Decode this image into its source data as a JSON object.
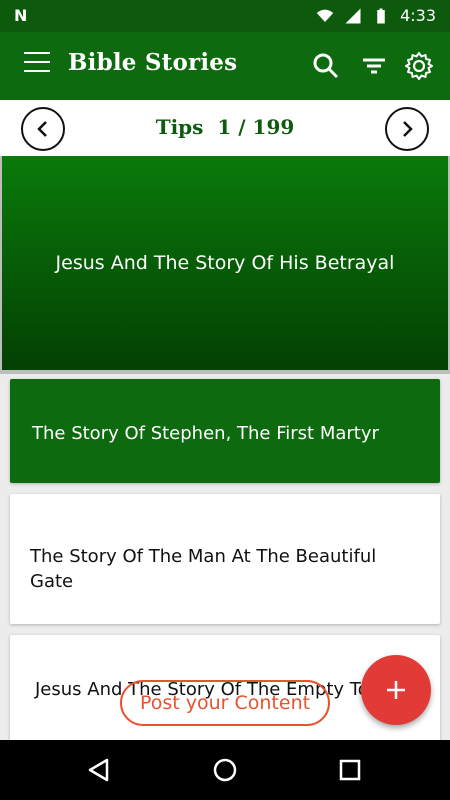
{
  "status_bar": {
    "left_icon": "N",
    "time": "4:33",
    "icons": [
      "wifi-icon",
      "signal-icon",
      "battery-icon"
    ]
  },
  "app_bar": {
    "title": "Bible Stories",
    "icons": [
      "menu-icon",
      "search-icon",
      "filter-icon",
      "gear-icon"
    ]
  },
  "tips": {
    "label": "Tips",
    "current": "1",
    "separator": "/",
    "total": "199"
  },
  "hero": {
    "title": "Jesus And The Story Of His Betrayal"
  },
  "cards": [
    {
      "title": "The Story Of Stephen, The First Martyr",
      "style": "green"
    },
    {
      "title": "The Story Of The Man At The Beautiful Gate",
      "style": "white"
    },
    {
      "title": "Jesus And The Story Of The Empty Tomb",
      "style": "white"
    }
  ],
  "post_button": {
    "label": "Post your Content"
  },
  "fab": {
    "label": "+"
  },
  "colors": {
    "primary": "#0e6a0e",
    "status_bar": "#0d5a0d",
    "accent": "#e23b37",
    "post_outline": "#e8532f"
  }
}
